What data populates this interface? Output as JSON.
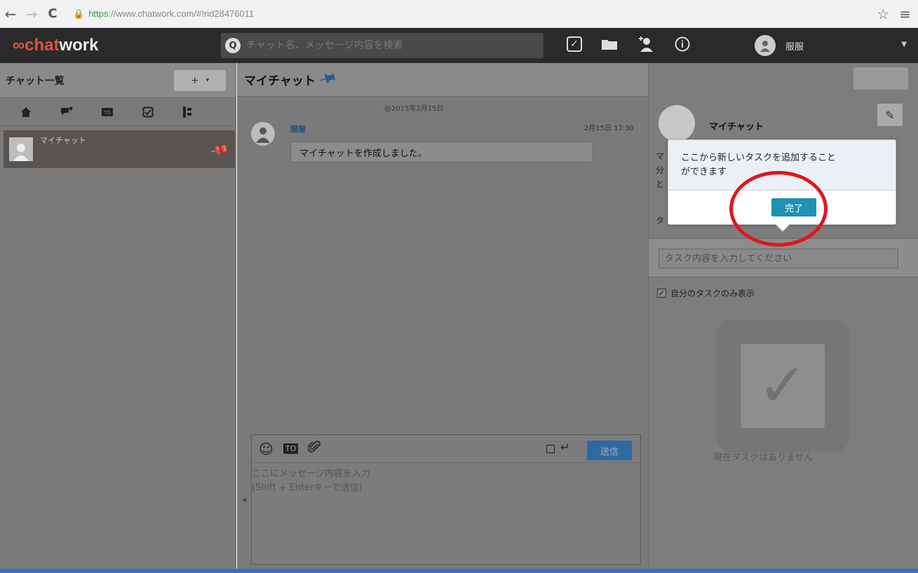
{
  "browser": {
    "url_https": "https",
    "url_rest": "://www.chatwork.com/#!rid28476011",
    "back_icon": "←",
    "forward_icon": "→",
    "reload_icon": "C",
    "star_icon": "☆",
    "menu_icon": "≡"
  },
  "header": {
    "logo_chat": "chat",
    "logo_work": "work",
    "search_placeholder": "チャット名、メッセージ内容を検索",
    "user_name": "服服"
  },
  "sidebar": {
    "title": "チャット一覧",
    "add_plus": "+",
    "add_caret": "▾",
    "filter_icons": [
      "home-icon",
      "unread-icon",
      "to-icon",
      "task-icon",
      "list-icon"
    ],
    "chats": [
      {
        "name": "マイチャット",
        "pinned": true
      }
    ]
  },
  "center": {
    "title": "マイチャット",
    "date_separator": "@2015年2月15日",
    "message": {
      "sender": "服服",
      "time": "2月15日 17:30",
      "text": "マイチャットを作成しました。"
    },
    "composer": {
      "send_label": "送信",
      "placeholder_line1": "ここにメッセージ内容を入力",
      "placeholder_line2": "(Shift + Enterキーで送信)"
    }
  },
  "right": {
    "profile_name": "マイチャット",
    "frag1": "マ",
    "frag2": "分",
    "frag3": "と",
    "frag4": "タ",
    "task_placeholder": "タスク内容を入力してください",
    "mine_label": "自分のタスクのみ表示",
    "empty_text": "現在タスクはありません"
  },
  "popover": {
    "line1": "ここから新しいタスクを追加すること",
    "line2": "ができます",
    "done_label": "完了"
  },
  "colors": {
    "header_bg": "#2a2a2a",
    "logo_accent": "#e0553a",
    "send_blue": "#2c6aa0",
    "done_teal": "#1f91b3",
    "highlight_red": "#e0161e",
    "bottom_blue": "#2f74c0"
  }
}
